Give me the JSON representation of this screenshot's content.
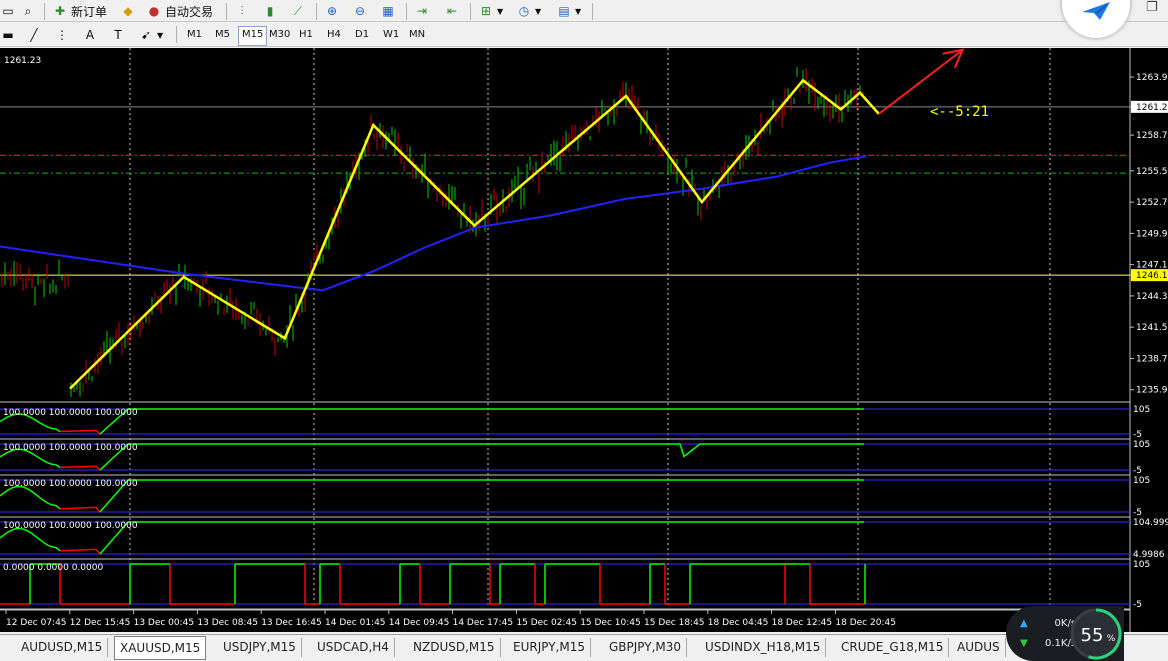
{
  "toolbar": {
    "new_order_label": "新订单",
    "auto_trade_label": "自动交易",
    "text_tool_label": "A",
    "timeframes": [
      "M1",
      "M5",
      "M15",
      "M30",
      "H1",
      "H4",
      "D1",
      "W1",
      "MN"
    ],
    "active_timeframe": "M15"
  },
  "chart_data": {
    "type": "line",
    "symbol": "XAUUSD,M15",
    "current_price_label": "1261.23",
    "price_levels": [
      1263.9,
      1261.23,
      1258.7,
      1255.5,
      1252.7,
      1249.9,
      1247.1,
      1246.16,
      1244.3,
      1241.5,
      1238.7,
      1235.9
    ],
    "price_level_labels": [
      "1263.90",
      "1261.23",
      "1258.70",
      "1255.50",
      "1252.70",
      "1249.90",
      "1247.10",
      "1246.16",
      "1244.30",
      "1241.50",
      "1238.70",
      "1235.90"
    ],
    "ylim": [
      1234.8,
      1266.5
    ],
    "highlight_price": 1246.16,
    "bid_price": 1261.23,
    "red_level": 1256.9,
    "green_level": 1255.3,
    "x_labels": [
      "12 Dec 07:45",
      "12 Dec 15:45",
      "13 Dec 00:45",
      "13 Dec 08:45",
      "13 Dec 16:45",
      "14 Dec 01:45",
      "14 Dec 09:45",
      "14 Dec 17:45",
      "15 Dec 02:45",
      "15 Dec 10:45",
      "15 Dec 18:45",
      "18 Dec 04:45",
      "18 Dec 12:45",
      "18 Dec 20:45"
    ],
    "zigzag": {
      "color": "#ffff00",
      "points": [
        [
          0,
          1236.0
        ],
        [
          9,
          1246.0
        ],
        [
          17,
          1240.5
        ],
        [
          24,
          1259.6
        ],
        [
          32,
          1250.6
        ],
        [
          44,
          1262.2
        ],
        [
          50,
          1252.7
        ],
        [
          58,
          1263.6
        ],
        [
          61,
          1261.0
        ],
        [
          62.5,
          1262.5
        ],
        [
          64,
          1260.6
        ]
      ]
    },
    "moving_average": {
      "color": "#2222ff",
      "points": [
        [
          -9,
          1249.3
        ],
        [
          0,
          1247.8
        ],
        [
          9,
          1246.3
        ],
        [
          17,
          1245.2
        ],
        [
          20,
          1244.8
        ],
        [
          24,
          1246.5
        ],
        [
          28,
          1248.6
        ],
        [
          32,
          1250.4
        ],
        [
          38,
          1251.5
        ],
        [
          44,
          1253.0
        ],
        [
          50,
          1253.9
        ],
        [
          56,
          1255.0
        ],
        [
          60,
          1256.2
        ],
        [
          63,
          1256.8
        ]
      ]
    },
    "projection_arrow": {
      "color": "#ff2020",
      "from": [
        64,
        1260.6
      ],
      "to": [
        67,
        1265.0
      ]
    },
    "annotation": {
      "text": "<--5:21",
      "color": "#ffff00"
    },
    "axis_labels": {
      "price_left": "1261.23"
    },
    "indicators": [
      {
        "name_label": "100.0000 100.0000 100.0000",
        "top_label": "105",
        "bottom_label": "-5",
        "values_hint": "saturated"
      },
      {
        "name_label": "100.0000 100.0000 100.0000",
        "top_label": "105",
        "bottom_label": "-5",
        "values_hint": "saturated"
      },
      {
        "name_label": "100.0000 100.0000 100.0000",
        "top_label": "105",
        "bottom_label": "-5",
        "values_hint": "saturated"
      },
      {
        "name_label": "100.0000 100.0000 100.0000",
        "top_label": "104.999",
        "bottom_label": "4.9986",
        "values_hint": "saturated"
      },
      {
        "name_label": "0.0000 0.0000 0.0000",
        "top_label": "105",
        "bottom_label": "-5",
        "values_hint": "oscillating"
      }
    ]
  },
  "tabs": [
    "AUDUSD,M15",
    "XAUUSD,M15",
    "USDJPY,M15",
    "USDCAD,H4",
    "NZDUSD,M15",
    "EURJPY,M15",
    "GBPJPY,M30",
    "USDINDX_H18,M15",
    "CRUDE_G18,M15",
    "AUDUS"
  ],
  "active_tab": "XAUUSD,M15",
  "network": {
    "down": "0",
    "up": "0.1",
    "unit_k": "K/s",
    "cpu_percent": "55",
    "percent_sign": "%"
  },
  "colors": {
    "background": "#000000",
    "grid": "#a0a0a0",
    "bull_candle": "#00cc00",
    "bear_candle": "#cc0000",
    "indicator_green": "#00ff00",
    "indicator_red": "#ff0000"
  }
}
